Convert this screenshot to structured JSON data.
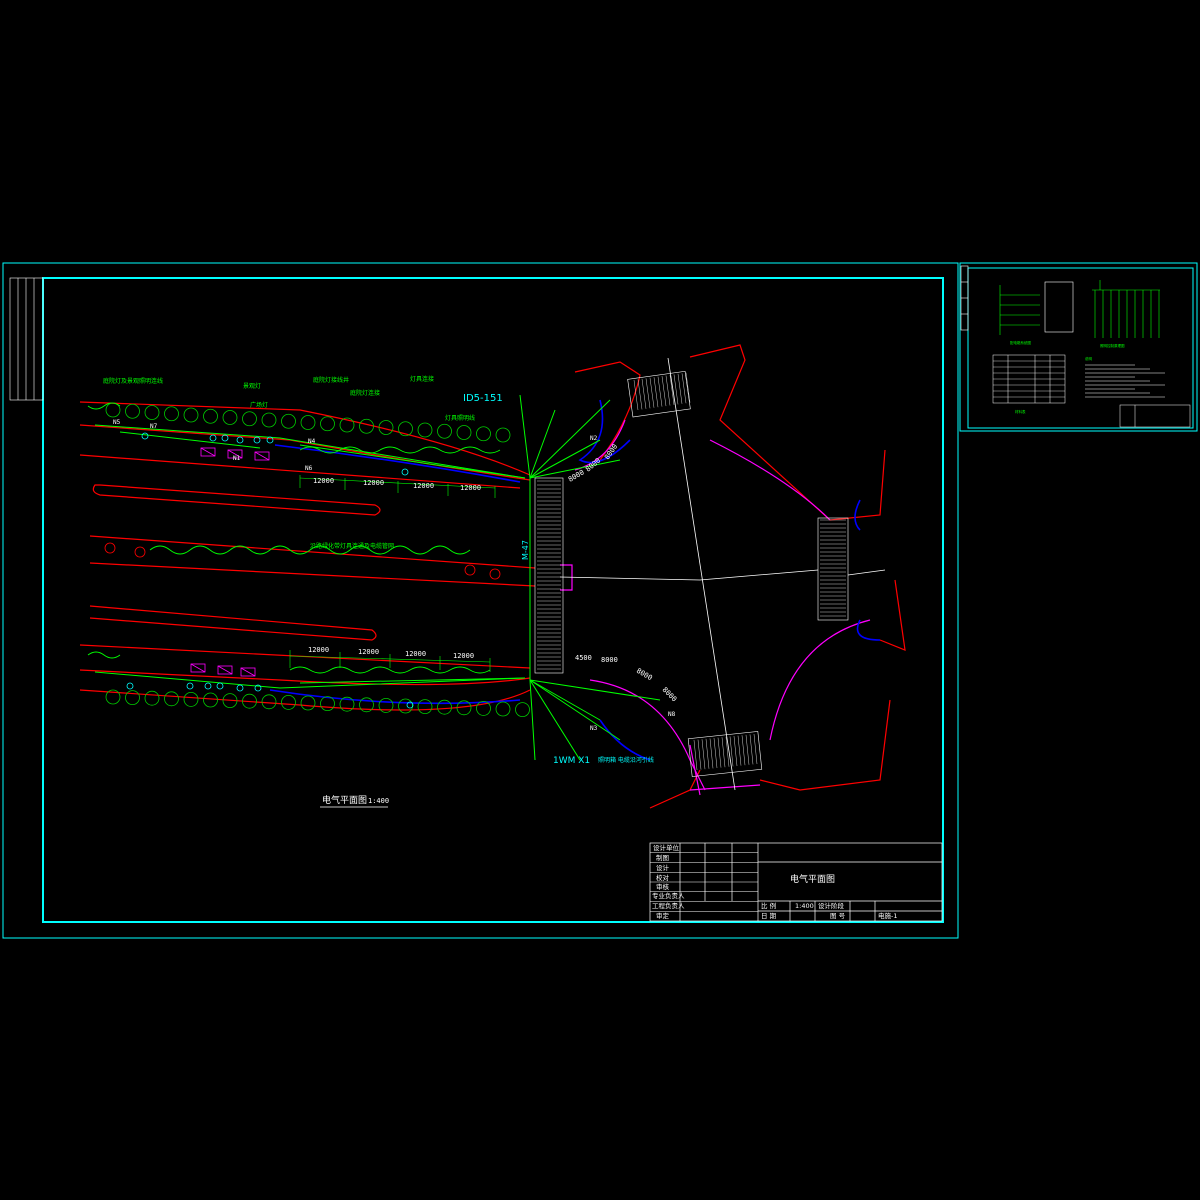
{
  "drawing": {
    "plan_title": "电气平面图",
    "plan_scale": "1:400",
    "annotation_fixture": "ID5-151",
    "annotation_cable": "1WM X1",
    "annotation_cable_note": "照明箱 电缆沿河引线",
    "vertical_label": "M-47",
    "dimensions_top": [
      "12000",
      "12000",
      "12000",
      "12000"
    ],
    "dimensions_bottom": [
      "12000",
      "12000",
      "12000",
      "12000"
    ],
    "dimensions_right_top": [
      "8000",
      "8000",
      "8000"
    ],
    "dimensions_right_bottom": [
      "4500",
      "8000",
      "8000",
      "8000"
    ],
    "fixture_tags": [
      "N1",
      "N2",
      "N3",
      "N4",
      "N5",
      "N6",
      "N7",
      "N8"
    ],
    "mid_band_label": "沿路绿化带灯具连通及电缆管网",
    "top_labels": [
      "庭院灯及景观照明连线",
      "景观灯",
      "广场灯",
      "庭院灯接线井",
      "庭院灯连接",
      "灯具连接",
      "灯具照明线"
    ]
  },
  "title_block": {
    "rows": [
      "设计单位",
      "制图",
      "设计",
      "校对",
      "审核",
      "专业负责人",
      "工程负责人",
      "审定"
    ],
    "title": "电气平面图",
    "scale_label": "比  例",
    "scale_value": "1:400",
    "stage_label": "设计阶段",
    "date_label": "日  期",
    "sheet_label": "图  号",
    "sheet_value": "电施-1"
  },
  "side_sheet": {
    "diagram1_caption": "配电箱系统图",
    "diagram2_caption": "照明控制原理图",
    "table_caption": "材料表",
    "notes_caption": "说明"
  },
  "colors": {
    "frame": "#00ffff",
    "road": "#ff0000",
    "light_line": "#00ff00",
    "water": "#0000ff",
    "curb": "#ff00ff",
    "text": "#ffffff"
  }
}
